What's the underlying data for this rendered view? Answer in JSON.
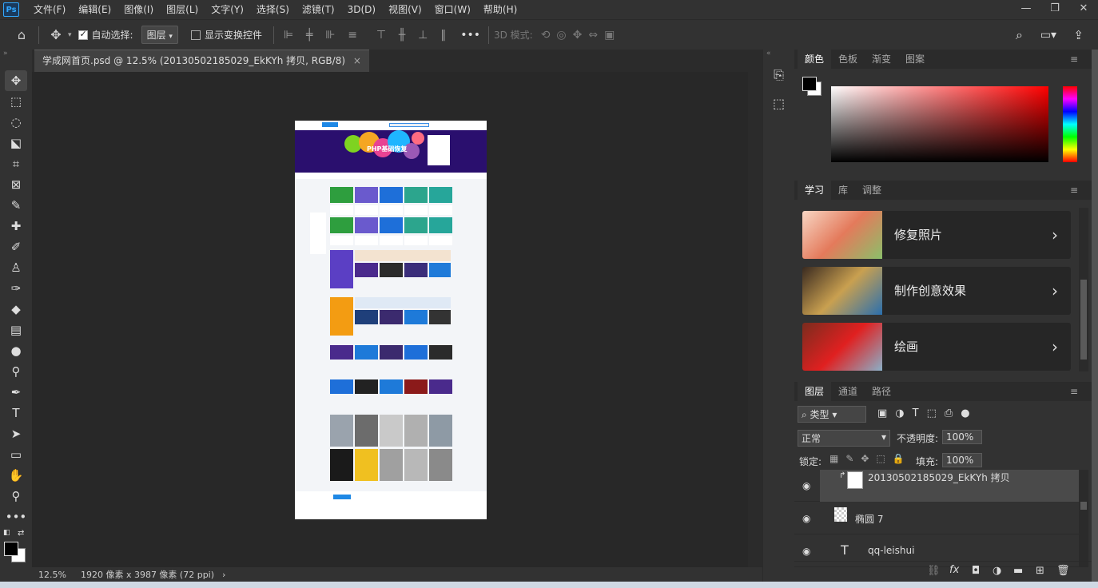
{
  "app": {
    "logo": "Ps"
  },
  "menu": [
    "文件(F)",
    "编辑(E)",
    "图像(I)",
    "图层(L)",
    "文字(Y)",
    "选择(S)",
    "滤镜(T)",
    "3D(D)",
    "视图(V)",
    "窗口(W)",
    "帮助(H)"
  ],
  "window_controls": {
    "minimize": "—",
    "restore": "❐",
    "close": "✕"
  },
  "options": {
    "auto_select_label": "自动选择:",
    "auto_select_value": "图层",
    "show_transform_label": "显示变换控件",
    "mode_3d_label": "3D 模式:",
    "more": "•••"
  },
  "document": {
    "tab_title": "学成网首页.psd @ 12.5% (20130502185029_EkKYh 拷贝, RGB/8)",
    "tab_close": "×",
    "banner_text": "PHP基础恢复"
  },
  "status": {
    "zoom": "12.5%",
    "size_info": "1920 像素 x 3987 像素 (72 ppi)",
    "arrow": "›"
  },
  "color_panel": {
    "tabs": [
      "颜色",
      "色板",
      "渐变",
      "图案"
    ],
    "active": 0,
    "accent": "#ff0000"
  },
  "learn_panel": {
    "tabs": [
      "学习",
      "库",
      "调整"
    ],
    "cards": [
      {
        "label": "修复照片"
      },
      {
        "label": "制作创意效果"
      },
      {
        "label": "绘画"
      }
    ]
  },
  "layers_panel": {
    "tabs": [
      "图层",
      "通道",
      "路径"
    ],
    "filter_kind": "类型",
    "blend_mode": "正常",
    "opacity_label": "不透明度:",
    "opacity_value": "100%",
    "lock_label": "锁定:",
    "fill_label": "填充:",
    "fill_value": "100%",
    "layers": [
      {
        "name": "20130502185029_EkKYh 拷贝",
        "type": "smart",
        "selected": true
      },
      {
        "name": "椭圆 7",
        "type": "shape",
        "selected": false
      },
      {
        "name": "qq-leishui",
        "type": "text",
        "selected": false
      }
    ],
    "bottom_icons": [
      "link-icon",
      "fx-icon",
      "mask-icon",
      "adjustment-icon",
      "folder-icon",
      "new-layer-icon",
      "trash-icon"
    ],
    "fx": "fx"
  }
}
